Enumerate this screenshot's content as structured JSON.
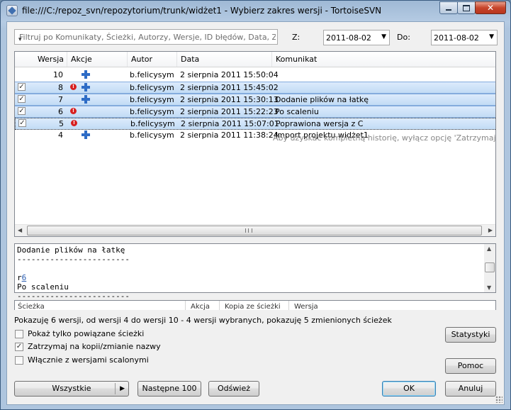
{
  "window": {
    "title": "file:///C:/repoz_svn/repozytorium/trunk/widżet1 - Wybierz zakres wersji - TortoiseSVN",
    "controls": {
      "minimize": "minimize",
      "maximize": "maximize",
      "close": "✕"
    }
  },
  "filter": {
    "placeholder": "Filtruj po Komunikaty, Ścieżki, Autorzy, Wersje, ID błędów, Data, Zakres da",
    "from_label": "Z:",
    "from_value": "2011-08-02",
    "to_label": "Do:",
    "to_value": "2011-08-02"
  },
  "log": {
    "columns": [
      "Wersja",
      "Akcje",
      "Autor",
      "Data",
      "Komunikat"
    ],
    "rows": [
      {
        "checked": false,
        "selected": false,
        "revision": "10",
        "actions": [
          "add"
        ],
        "author": "b.felicysym",
        "date": "2 sierpnia 2011 15:50:04",
        "message": ""
      },
      {
        "checked": true,
        "selected": true,
        "revision": "8",
        "actions": [
          "conflict",
          "add"
        ],
        "author": "b.felicysym",
        "date": "2 sierpnia 2011 15:45:02",
        "message": ""
      },
      {
        "checked": true,
        "selected": true,
        "revision": "7",
        "actions": [
          "add"
        ],
        "author": "b.felicysym",
        "date": "2 sierpnia 2011 15:30:13",
        "message": "Dodanie plików na łatkę"
      },
      {
        "checked": true,
        "selected": true,
        "revision": "6",
        "actions": [
          "conflict"
        ],
        "author": "b.felicysym",
        "date": "2 sierpnia 2011 15:22:23",
        "message": "Po scaleniu"
      },
      {
        "checked": true,
        "selected": true,
        "focused": true,
        "revision": "5",
        "actions": [
          "conflict"
        ],
        "author": "b.felicysym",
        "date": "2 sierpnia 2011 15:07:01",
        "message": "Poprawiona wersja z C"
      },
      {
        "checked": false,
        "selected": false,
        "revision": "4",
        "actions": [
          "add"
        ],
        "author": "b.felicysym",
        "date": "2 sierpnia 2011 11:38:24",
        "message": "Import projektu widżet1"
      }
    ],
    "hint": "Aby uzyskać kompletną historię, wyłącz opcję 'Zatrzymaj na kopii/",
    "hscroll_arrows": {
      "left": "◀",
      "right": "▶"
    }
  },
  "message_pane": {
    "line1": "Dodanie plików na łatkę",
    "line2": "------------------------",
    "line3_prefix": "r",
    "line3_link": "6",
    "line4": "Po scaleniu",
    "line5": "------------------------",
    "vscroll_arrows": {
      "up": "▲",
      "down": "▼"
    }
  },
  "paths": {
    "columns": [
      "Ścieżka",
      "Akcja",
      "Kopia ze ścieżki",
      "Wersja"
    ]
  },
  "status_text": "Pokazuję 6 wersji, od wersji 4 do wersji 10 - 4 wersji wybranych, pokazuję 5 zmienionych ścieżek",
  "options": {
    "show_related": {
      "label": "Pokaż tylko powiązane ścieżki",
      "checked": false
    },
    "stop_on_copy": {
      "label": "Zatrzymaj na kopii/zmianie nazwy",
      "checked": true
    },
    "include_merged": {
      "label": "Włącznie z wersjami scalonymi",
      "checked": false
    }
  },
  "buttons": {
    "statistics": "Statystyki",
    "help": "Pomoc",
    "all": "Wszystkie",
    "next100": "Następne 100",
    "refresh": "Odśwież",
    "ok": "OK",
    "cancel": "Anuluj"
  },
  "colors": {
    "selection_top": "#dcebfc",
    "selection_bottom": "#c2dcf5",
    "conflict_red": "#d71f1f",
    "add_blue": "#2e6cc6",
    "link_blue": "#2a5db0"
  }
}
